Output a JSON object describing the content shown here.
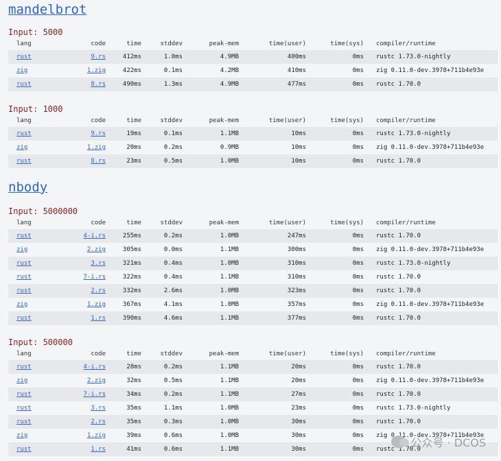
{
  "columns": [
    "lang",
    "code",
    "time",
    "stddev",
    "peak-mem",
    "time(user)",
    "time(sys)",
    "compiler/runtime"
  ],
  "sections": [
    {
      "title": "mandelbrot",
      "groups": [
        {
          "input": "Input: 5000",
          "rows": [
            [
              "rust",
              "9.rs",
              "412ms",
              "1.0ms",
              "4.9MB",
              "400ms",
              "0ms",
              "rustc 1.73.0-nightly"
            ],
            [
              "zig",
              "1.zig",
              "422ms",
              "0.1ms",
              "4.2MB",
              "410ms",
              "0ms",
              "zig 0.11.0-dev.3978+711b4e93e"
            ],
            [
              "rust",
              "8.rs",
              "490ms",
              "1.3ms",
              "4.9MB",
              "477ms",
              "0ms",
              "rustc 1.70.0"
            ]
          ]
        },
        {
          "input": "Input: 1000",
          "rows": [
            [
              "rust",
              "9.rs",
              "19ms",
              "0.1ms",
              "1.1MB",
              "10ms",
              "0ms",
              "rustc 1.73.0-nightly"
            ],
            [
              "zig",
              "1.zig",
              "20ms",
              "0.2ms",
              "0.9MB",
              "10ms",
              "0ms",
              "zig 0.11.0-dev.3978+711b4e93e"
            ],
            [
              "rust",
              "8.rs",
              "23ms",
              "0.5ms",
              "1.0MB",
              "10ms",
              "0ms",
              "rustc 1.70.0"
            ]
          ]
        }
      ]
    },
    {
      "title": "nbody",
      "groups": [
        {
          "input": "Input: 5000000",
          "rows": [
            [
              "rust",
              "4-i.rs",
              "255ms",
              "0.2ms",
              "1.0MB",
              "247ms",
              "0ms",
              "rustc 1.70.0"
            ],
            [
              "zig",
              "2.zig",
              "305ms",
              "0.0ms",
              "1.1MB",
              "300ms",
              "0ms",
              "zig 0.11.0-dev.3978+711b4e93e"
            ],
            [
              "rust",
              "3.rs",
              "321ms",
              "0.4ms",
              "1.0MB",
              "310ms",
              "0ms",
              "rustc 1.73.0-nightly"
            ],
            [
              "rust",
              "7-i.rs",
              "322ms",
              "0.4ms",
              "1.1MB",
              "310ms",
              "0ms",
              "rustc 1.70.0"
            ],
            [
              "rust",
              "2.rs",
              "332ms",
              "2.6ms",
              "1.0MB",
              "323ms",
              "0ms",
              "rustc 1.70.0"
            ],
            [
              "zig",
              "1.zig",
              "367ms",
              "4.1ms",
              "1.0MB",
              "357ms",
              "0ms",
              "zig 0.11.0-dev.3978+711b4e93e"
            ],
            [
              "rust",
              "1.rs",
              "390ms",
              "4.6ms",
              "1.1MB",
              "377ms",
              "0ms",
              "rustc 1.70.0"
            ]
          ]
        },
        {
          "input": "Input: 500000",
          "rows": [
            [
              "rust",
              "4-i.rs",
              "28ms",
              "0.2ms",
              "1.1MB",
              "20ms",
              "0ms",
              "rustc 1.70.0"
            ],
            [
              "zig",
              "2.zig",
              "32ms",
              "0.5ms",
              "1.1MB",
              "20ms",
              "0ms",
              "zig 0.11.0-dev.3978+711b4e93e"
            ],
            [
              "rust",
              "7-i.rs",
              "34ms",
              "0.2ms",
              "1.1MB",
              "27ms",
              "0ms",
              "rustc 1.70.0"
            ],
            [
              "rust",
              "3.rs",
              "35ms",
              "1.1ms",
              "1.0MB",
              "23ms",
              "0ms",
              "rustc 1.73.0-nightly"
            ],
            [
              "rust",
              "2.rs",
              "35ms",
              "0.3ms",
              "1.0MB",
              "30ms",
              "0ms",
              "rustc 1.70.0"
            ],
            [
              "zig",
              "1.zig",
              "39ms",
              "0.6ms",
              "1.0MB",
              "30ms",
              "0ms",
              "zig 0.11.0-dev.3978+711b4e93e"
            ],
            [
              "rust",
              "1.rs",
              "41ms",
              "0.6ms",
              "1.1MB",
              "30ms",
              "0ms",
              "rustc 1.70.0"
            ]
          ]
        }
      ]
    }
  ],
  "watermark": {
    "text": "公众号 · DCOS",
    "icon": "wechat-icon"
  },
  "colors": {
    "link": "#2f63d6",
    "input_title": "#8a1f1f",
    "row_stripe": "#e6e8ec",
    "background": "#f4f5f7"
  }
}
